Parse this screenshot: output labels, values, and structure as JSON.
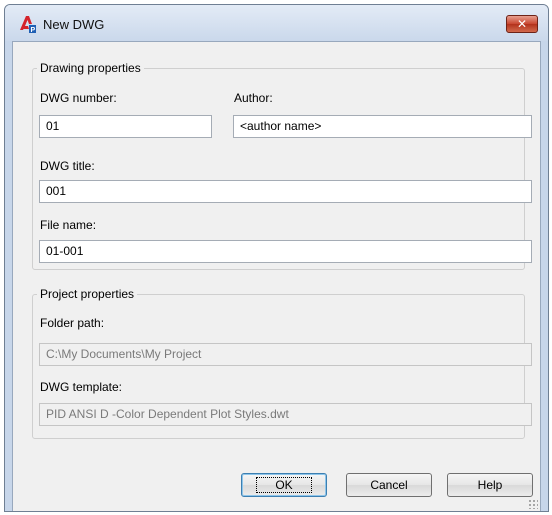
{
  "window": {
    "title": "New DWG",
    "close_glyph": "✕",
    "app_icon": "autocad-p-icon"
  },
  "drawing_properties": {
    "legend": "Drawing properties",
    "dwg_number": {
      "label": "DWG number:",
      "value": "01"
    },
    "author": {
      "label": "Author:",
      "value": "<author name>"
    },
    "dwg_title": {
      "label": "DWG title:",
      "value": "001"
    },
    "file_name": {
      "label": "File name:",
      "value": "01-001"
    }
  },
  "project_properties": {
    "legend": "Project properties",
    "folder_path": {
      "label": "Folder path:",
      "value": "C:\\My Documents\\My Project"
    },
    "dwg_template": {
      "label": "DWG template:",
      "value": "PID ANSI D -Color Dependent Plot Styles.dwt"
    }
  },
  "buttons": {
    "ok": "OK",
    "cancel": "Cancel",
    "help": "Help"
  },
  "colors": {
    "close_button": "#c8452f",
    "icon_red": "#d4242c",
    "icon_blue": "#1f5fb4"
  }
}
